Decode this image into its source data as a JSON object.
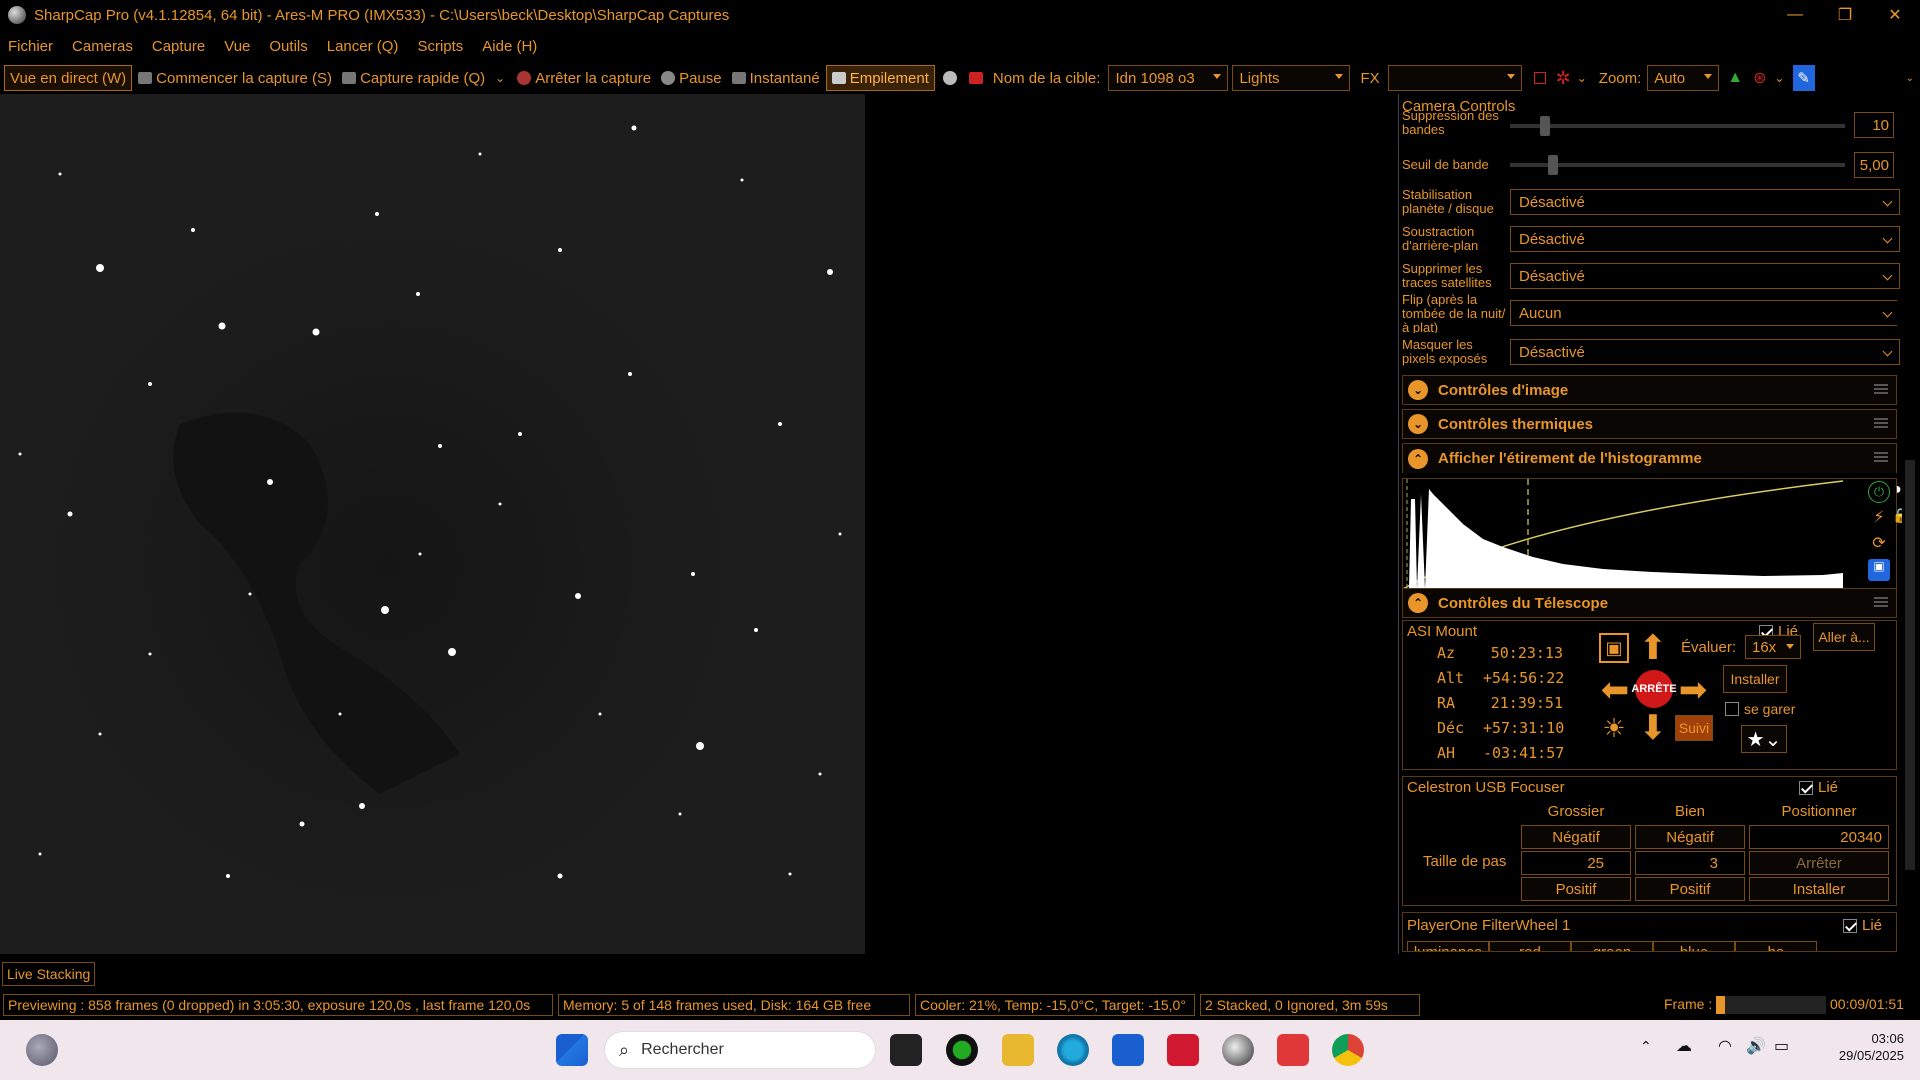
{
  "window": {
    "title": "SharpCap Pro (v4.1.12854, 64 bit) - Ares-M PRO (IMX533) - C:\\Users\\beck\\Desktop\\SharpCap Captures",
    "minimize": "—",
    "maximize": "❐",
    "close": "✕"
  },
  "menu": [
    "Fichier",
    "Cameras",
    "Capture",
    "Vue",
    "Outils",
    "Lancer (Q)",
    "Scripts",
    "Aide (H)"
  ],
  "toolbar": {
    "live_view": "Vue en direct (W)",
    "start_capture": "Commencer la capture (S)",
    "quick_capture": "Capture rapide (Q)",
    "stop_capture": "Arrêter la capture",
    "pause": "Pause",
    "snapshot": "Instantané",
    "stacking": "Empilement",
    "target_label": "Nom de la cible:",
    "target_value": "Idn 1098 o3",
    "frame_type": "Lights",
    "fx_label": "FX",
    "fx_value": "",
    "zoom_label": "Zoom:",
    "zoom_value": "Auto"
  },
  "camera_controls": {
    "title": "Camera Controls",
    "band_suppression_label": "Suppression des bandes",
    "band_suppression_value": "10",
    "band_threshold_label": "Seuil de bande",
    "band_threshold_value": "5,00",
    "settings": [
      {
        "label": "Stabilisation planète / disque",
        "value": "Désactivé"
      },
      {
        "label": "Soustraction d'arrière-plan",
        "value": "Désactivé"
      },
      {
        "label": "Supprimer les traces satellites",
        "value": "Désactivé"
      },
      {
        "label": "Flip (après la tombée de la nuit/à plat)",
        "value": "Aucun"
      },
      {
        "label": "Masquer les pixels exposés",
        "value": "Désactivé"
      }
    ],
    "sections": {
      "image_controls": "Contrôles d'image",
      "thermal_controls": "Contrôles thermiques",
      "histogram": "Afficher l'étirement de l'histogramme",
      "telescope": "Contrôles du Télescope"
    }
  },
  "mount": {
    "name": "ASI Mount",
    "linked_label": "Lié",
    "goto": "Aller à...",
    "rate_label": "Évaluer:",
    "rate_value": "16x",
    "install": "Installer",
    "park_label": "se garer",
    "stop": "ARRÊTE",
    "track": "Suivi",
    "coords": [
      {
        "label": "Az",
        "value": "50:23:13"
      },
      {
        "label": "Alt",
        "value": "+54:56:22"
      },
      {
        "label": "RA",
        "value": "21:39:51"
      },
      {
        "label": "Déc",
        "value": "+57:31:10"
      },
      {
        "label": "AH",
        "value": "-03:41:57"
      }
    ]
  },
  "focuser": {
    "name": "Celestron USB Focuser",
    "linked_label": "Lié",
    "coarse": "Grossier",
    "fine": "Bien",
    "position": "Positionner",
    "negative": "Négatif",
    "positive": "Positif",
    "position_value": "20340",
    "step_label": "Taille de pas",
    "coarse_step": "25",
    "fine_step": "3",
    "stop": "Arrêter",
    "install": "Installer"
  },
  "filterwheel": {
    "name": "PlayerOne FilterWheel 1",
    "linked_label": "Lié",
    "filters": [
      "luminance",
      "red",
      "green",
      "blue",
      "ha"
    ]
  },
  "status": {
    "live_stacking": "Live Stacking",
    "preview": "Previewing : 858 frames (0 dropped) in 3:05:30, exposure 120,0s , last frame 120,0s",
    "memory": "Memory: 5 of 148 frames used, Disk: 164 GB free",
    "cooler": "Cooler: 21%, Temp: -15,0°C, Target: -15,0°",
    "stack": "2 Stacked, 0 Ignored, 3m 59s",
    "frame_label": "Frame :",
    "frame_progress": 0.08,
    "frame_time": "00:09/01:51"
  },
  "taskbar": {
    "search_placeholder": "Rechercher",
    "time": "03:06",
    "date": "29/05/2025"
  },
  "colors": {
    "accent": "#e8962a",
    "background": "#000000",
    "taskbar": "#f1e6ec"
  }
}
